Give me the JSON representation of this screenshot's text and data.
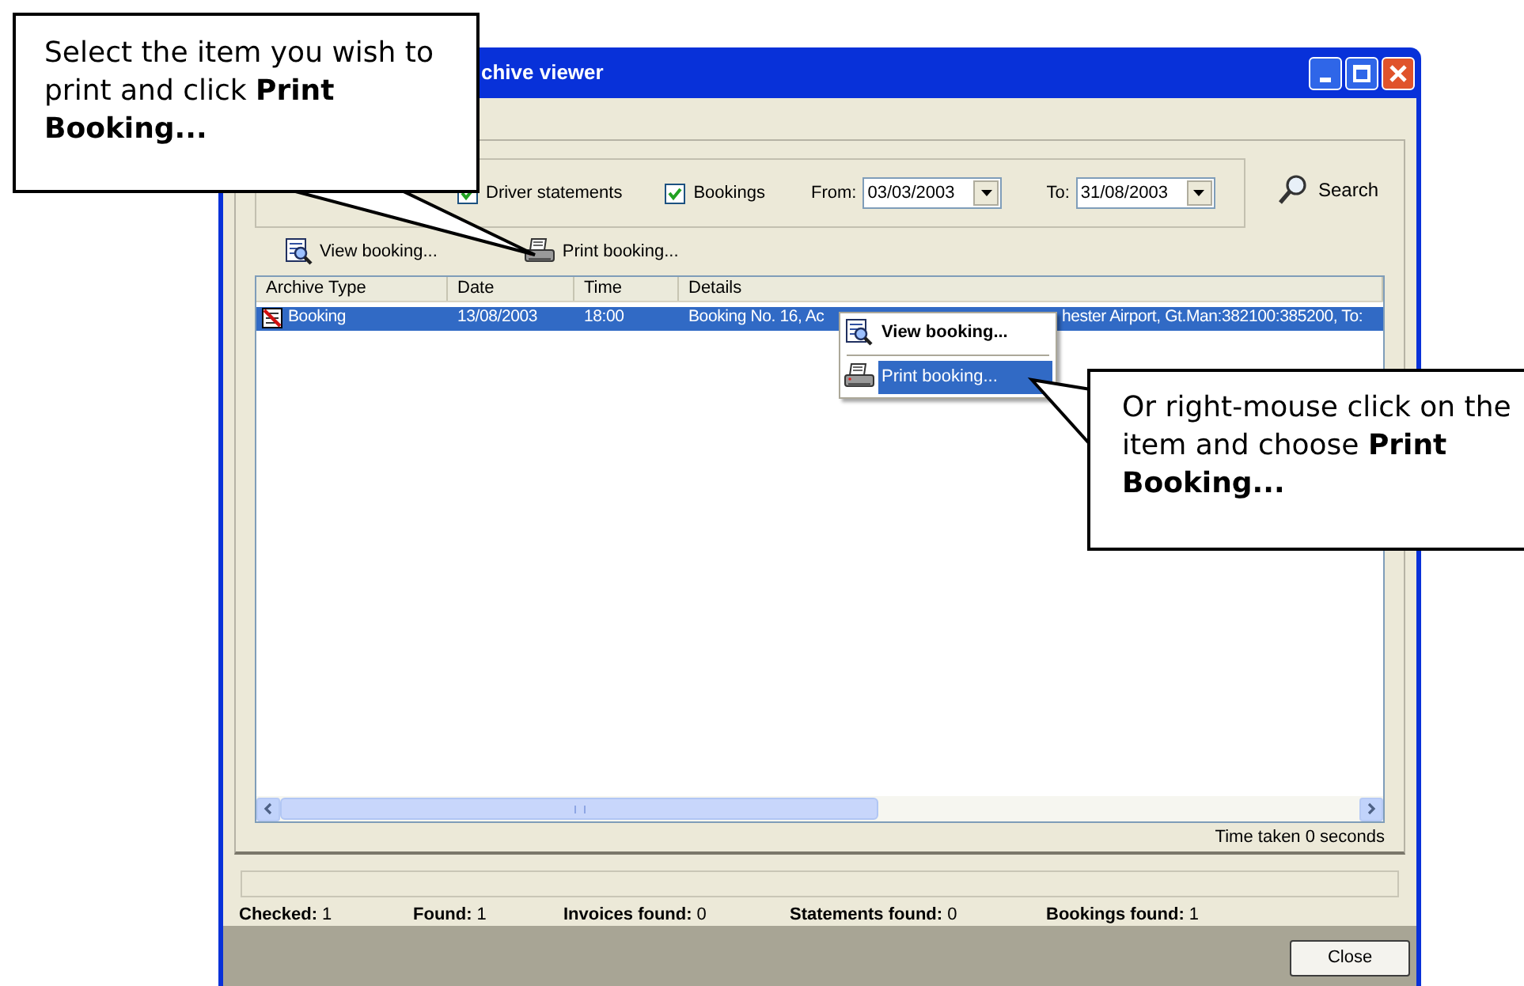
{
  "callouts": [
    {
      "text": "Select the item you wish to print and click **Print Booking...**"
    },
    {
      "text": "Or right-mouse click on the item and choose **Print Booking...**"
    }
  ],
  "window": {
    "title": "chive viewer"
  },
  "filters": {
    "checkboxes": [
      {
        "label": "Driver statements",
        "checked": true
      },
      {
        "label": "Bookings",
        "checked": true
      }
    ],
    "from_label": "From:",
    "from_value": "03/03/2003",
    "to_label": "To:",
    "to_value": "31/08/2003"
  },
  "search_button": "Search",
  "toolbar": [
    {
      "label": "View booking...",
      "kind": "view"
    },
    {
      "label": "Print booking...",
      "kind": "print"
    }
  ],
  "table": {
    "columns": [
      "Archive Type",
      "Date",
      "Time",
      "Details"
    ],
    "rows": [
      {
        "archive_type": "Booking",
        "date": "13/08/2003",
        "time": "18:00",
        "details": [
          "Booking No. 16, Ac",
          "hester Airport, Gt.Man:382100:385200, To:"
        ],
        "selected": true
      }
    ]
  },
  "context_menu": [
    {
      "label": "View booking...",
      "kind": "view",
      "default": true,
      "selected": false
    },
    {
      "label": "Print booking...",
      "kind": "print",
      "default": false,
      "selected": true
    }
  ],
  "time_taken": "Time taken 0 seconds",
  "stats": [
    {
      "label": "Checked:",
      "value": "1"
    },
    {
      "label": "Found:",
      "value": "1"
    },
    {
      "label": "Invoices found:",
      "value": "0"
    },
    {
      "label": "Statements found:",
      "value": "0"
    },
    {
      "label": "Bookings found:",
      "value": "1"
    }
  ],
  "progress": {
    "level": 0
  },
  "close_button": "Close"
}
